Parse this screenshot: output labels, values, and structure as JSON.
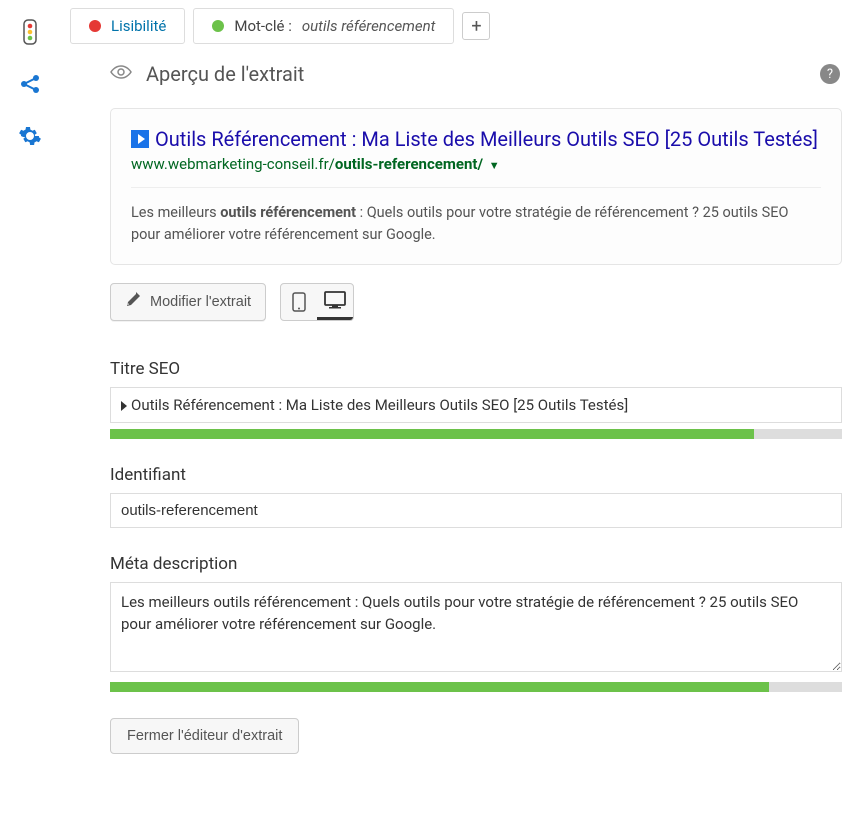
{
  "tabs": {
    "readability": "Lisibilité",
    "keyword_label": "Mot-clé : ",
    "keyword_value": "outils référencement"
  },
  "snippet": {
    "header": "Aperçu de l'extrait",
    "title": "Outils Référencement : Ma Liste des Meilleurs Outils SEO [25 Outils Testés]",
    "url_base": "www.webmarketing-conseil.fr/",
    "url_slug": "outils-referencement/",
    "desc_prefix": "Les meilleurs ",
    "desc_bold": "outils référencement",
    "desc_rest": " : Quels outils pour votre stratégie de référencement ? 25 outils SEO pour améliorer votre référencement sur Google.",
    "edit_button": "Modifier l'extrait"
  },
  "fields": {
    "seo_title_label": "Titre SEO",
    "seo_title_value": "Outils Référencement : Ma Liste des Meilleurs Outils SEO [25 Outils Testés]",
    "seo_title_progress": 88,
    "slug_label": "Identifiant",
    "slug_value": "outils-referencement",
    "meta_label": "Méta description",
    "meta_value": "Les meilleurs outils référencement : Quels outils pour votre stratégie de référencement ? 25 outils SEO pour améliorer votre référencement sur Google.",
    "meta_progress": 90
  },
  "close_button": "Fermer l'éditeur d'extrait"
}
